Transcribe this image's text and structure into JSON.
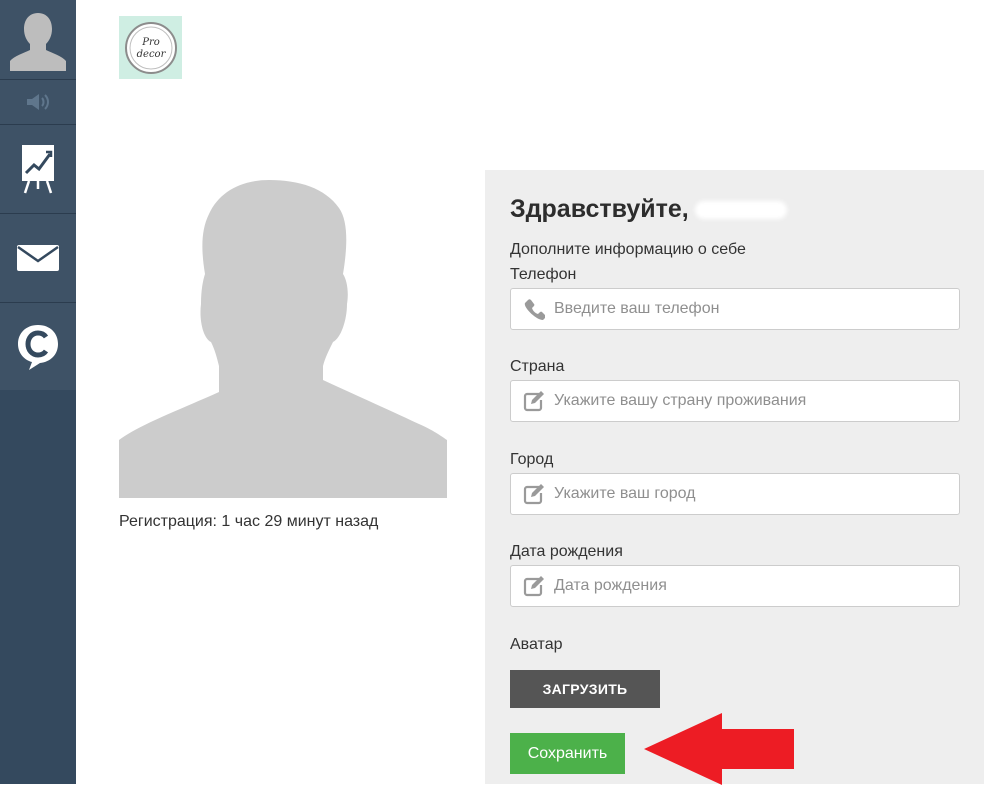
{
  "sidebar": {
    "items": [
      {
        "icon": "user-icon"
      },
      {
        "icon": "speaker-icon"
      },
      {
        "icon": "chart-easel-icon"
      },
      {
        "icon": "mail-icon"
      },
      {
        "icon": "chat-c-icon"
      }
    ]
  },
  "logo": {
    "text": "Pro decor"
  },
  "profile": {
    "registration": "Регистрация: 1 час 29 минут назад"
  },
  "form": {
    "greeting": "Здравствуйте,",
    "subtitle": "Дополните информацию о себе",
    "phone": {
      "label": "Телефон",
      "placeholder": "Введите ваш телефон",
      "value": ""
    },
    "country": {
      "label": "Страна",
      "placeholder": "Укажите вашу страну проживания",
      "value": ""
    },
    "city": {
      "label": "Город",
      "placeholder": "Укажите ваш город",
      "value": ""
    },
    "birthdate": {
      "label": "Дата рождения",
      "placeholder": "Дата рождения",
      "value": ""
    },
    "avatar_label": "Аватар",
    "upload_button": "ЗАГРУЗИТЬ",
    "save_button": "Сохранить"
  },
  "colors": {
    "sidebar_bg": "#34495e",
    "panel_bg": "#eeeeee",
    "save_green": "#4cb14a",
    "upload_gray": "#555555",
    "arrow_red": "#ed1c24"
  }
}
